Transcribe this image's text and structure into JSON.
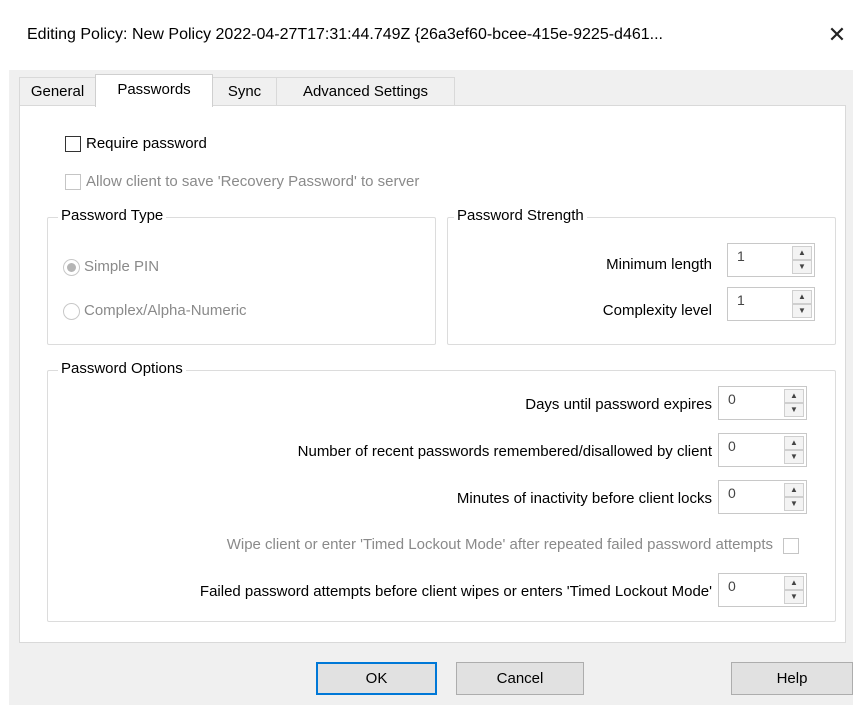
{
  "window": {
    "title": "Editing Policy:  New Policy 2022-04-27T17:31:44.749Z {26a3ef60-bcee-415e-9225-d461...",
    "close_glyph": "✕"
  },
  "tabs": [
    {
      "label": "General",
      "active": false
    },
    {
      "label": "Passwords",
      "active": true
    },
    {
      "label": "Sync",
      "active": false
    },
    {
      "label": "Advanced Settings",
      "active": false
    }
  ],
  "passwords": {
    "require_password": {
      "label": "Require password",
      "checked": false
    },
    "allow_recovery": {
      "label": "Allow client to save 'Recovery Password' to server",
      "checked": false,
      "enabled": false
    },
    "password_type": {
      "title": "Password Type",
      "options": [
        {
          "label": "Simple PIN",
          "selected": true
        },
        {
          "label": "Complex/Alpha-Numeric",
          "selected": false
        }
      ]
    },
    "password_strength": {
      "title": "Password Strength",
      "minimum_length": {
        "label": "Minimum length",
        "value": "1"
      },
      "complexity_level": {
        "label": "Complexity level",
        "value": "1"
      }
    },
    "password_options": {
      "title": "Password Options",
      "days_until_expires": {
        "label": "Days until password expires",
        "value": "0"
      },
      "recent_passwords": {
        "label": "Number of recent passwords remembered/disallowed by client",
        "value": "0"
      },
      "inactivity_minutes": {
        "label": "Minutes of inactivity before client locks",
        "value": "0"
      },
      "wipe_or_lockout": {
        "label": "Wipe client or enter 'Timed Lockout Mode' after repeated failed password attempts",
        "checked": false
      },
      "failed_attempts": {
        "label": "Failed password attempts before client wipes or enters 'Timed Lockout Mode'",
        "value": "0"
      }
    }
  },
  "buttons": {
    "ok": "OK",
    "cancel": "Cancel",
    "help": "Help"
  },
  "spinner": {
    "up": "▲",
    "down": "▼"
  }
}
